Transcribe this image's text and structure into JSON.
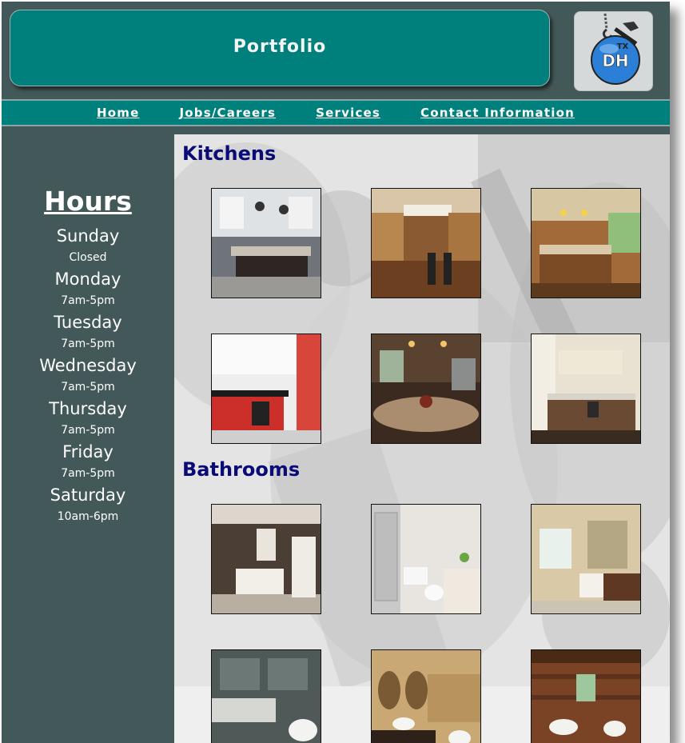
{
  "header": {
    "title": "Portfolio",
    "logo_text": "DH",
    "logo_small_text": "TX"
  },
  "nav": {
    "items": [
      {
        "label": "Home"
      },
      {
        "label": "Jobs/Careers"
      },
      {
        "label": "Services"
      },
      {
        "label": "Contact Information"
      }
    ]
  },
  "sidebar": {
    "heading": "Hours",
    "days": [
      {
        "day": "Sunday",
        "time": "Closed"
      },
      {
        "day": "Monday",
        "time": "7am-5pm"
      },
      {
        "day": "Tuesday",
        "time": "7am-5pm"
      },
      {
        "day": "Wednesday",
        "time": "7am-5pm"
      },
      {
        "day": "Thursday",
        "time": "7am-5pm"
      },
      {
        "day": "Friday",
        "time": "7am-5pm"
      },
      {
        "day": "Saturday",
        "time": "10am-6pm"
      }
    ]
  },
  "sections": {
    "kitchens": {
      "heading": "Kitchens",
      "photos": [
        "kitchen-photo",
        "kitchen-photo",
        "kitchen-photo",
        "kitchen-photo",
        "kitchen-photo",
        "kitchen-photo"
      ]
    },
    "bathrooms": {
      "heading": "Bathrooms",
      "photos": [
        "bathroom-photo",
        "bathroom-photo",
        "bathroom-photo",
        "bathroom-photo",
        "bathroom-photo",
        "bathroom-photo"
      ]
    }
  },
  "colors": {
    "frame": "#435858",
    "teal": "#00807d",
    "section_heading": "#0b0b78",
    "logo_blue": "#2b7fd6"
  }
}
